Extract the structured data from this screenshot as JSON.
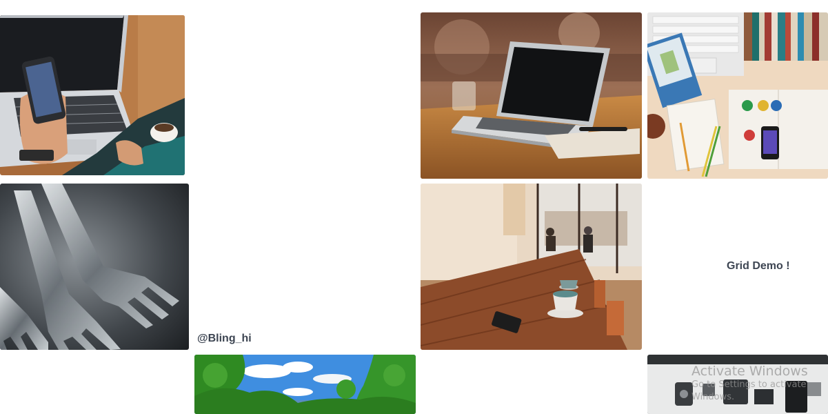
{
  "labels": {
    "handle": "@Bling_hi",
    "grid_demo": "Grid Demo !"
  },
  "watermark": {
    "title": "Activate Windows",
    "subtitle": "Go to Settings to activate Windows."
  },
  "colors": {
    "label_text": "#3d4552",
    "background": "#ffffff"
  },
  "tiles": [
    {
      "name": "photo-laptop-hand-phone",
      "icon": "photo"
    },
    {
      "name": "photo-laptop-on-table",
      "icon": "photo"
    },
    {
      "name": "photo-desk-flatlay",
      "icon": "photo"
    },
    {
      "name": "photo-forks",
      "icon": "photo"
    },
    {
      "name": "photo-cafe-table",
      "icon": "photo"
    },
    {
      "name": "photo-forest",
      "icon": "photo"
    },
    {
      "name": "photo-gadgets",
      "icon": "photo"
    }
  ]
}
